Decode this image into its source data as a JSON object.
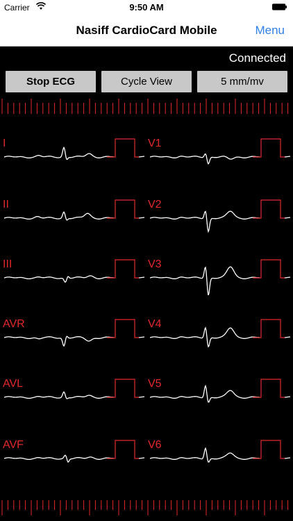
{
  "status_bar": {
    "carrier": "Carrier",
    "time": "9:50 AM"
  },
  "nav": {
    "title": "Nasiff CardioCard Mobile",
    "menu_label": "Menu"
  },
  "connection_status": "Connected",
  "controls": {
    "stop_label": "Stop ECG",
    "cycle_label": "Cycle View",
    "scale_label": "5 mm/mv"
  },
  "leads": {
    "left": [
      "I",
      "II",
      "III",
      "AVR",
      "AVL",
      "AVF"
    ],
    "right": [
      "V1",
      "V2",
      "V3",
      "V4",
      "V5",
      "V6"
    ]
  },
  "colors": {
    "accent": "#e3282b",
    "trace": "#ffffff",
    "link": "#2f7fe6",
    "background": "#000000"
  }
}
